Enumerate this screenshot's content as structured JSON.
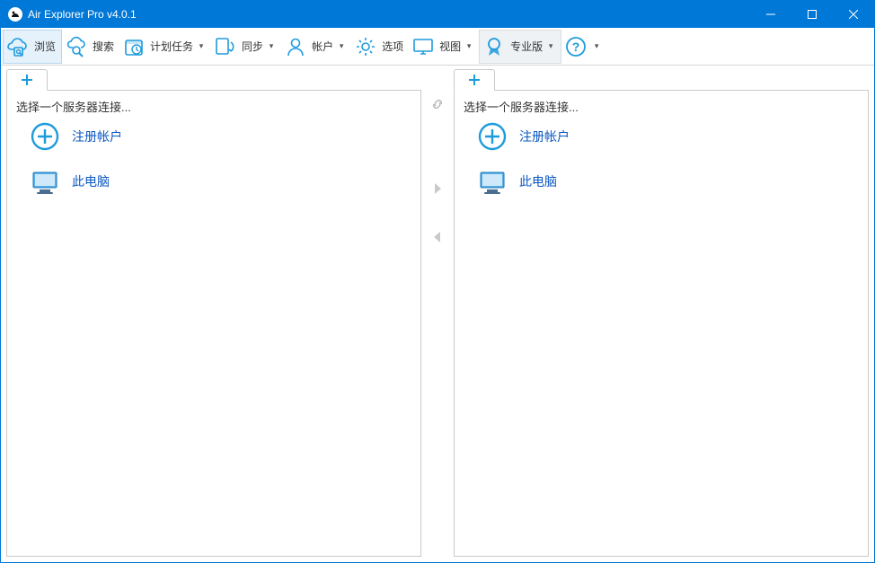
{
  "window": {
    "title": "Air Explorer Pro v4.0.1"
  },
  "toolbar": {
    "browse": "浏览",
    "search": "搜索",
    "tasks": "计划任务",
    "sync": "同步",
    "accounts": "帐户",
    "options": "选项",
    "view": "视图",
    "pro": "专业版"
  },
  "pane": {
    "prompt": "选择一个服务器连接...",
    "register": "注册帐户",
    "this_pc": "此电脑"
  }
}
